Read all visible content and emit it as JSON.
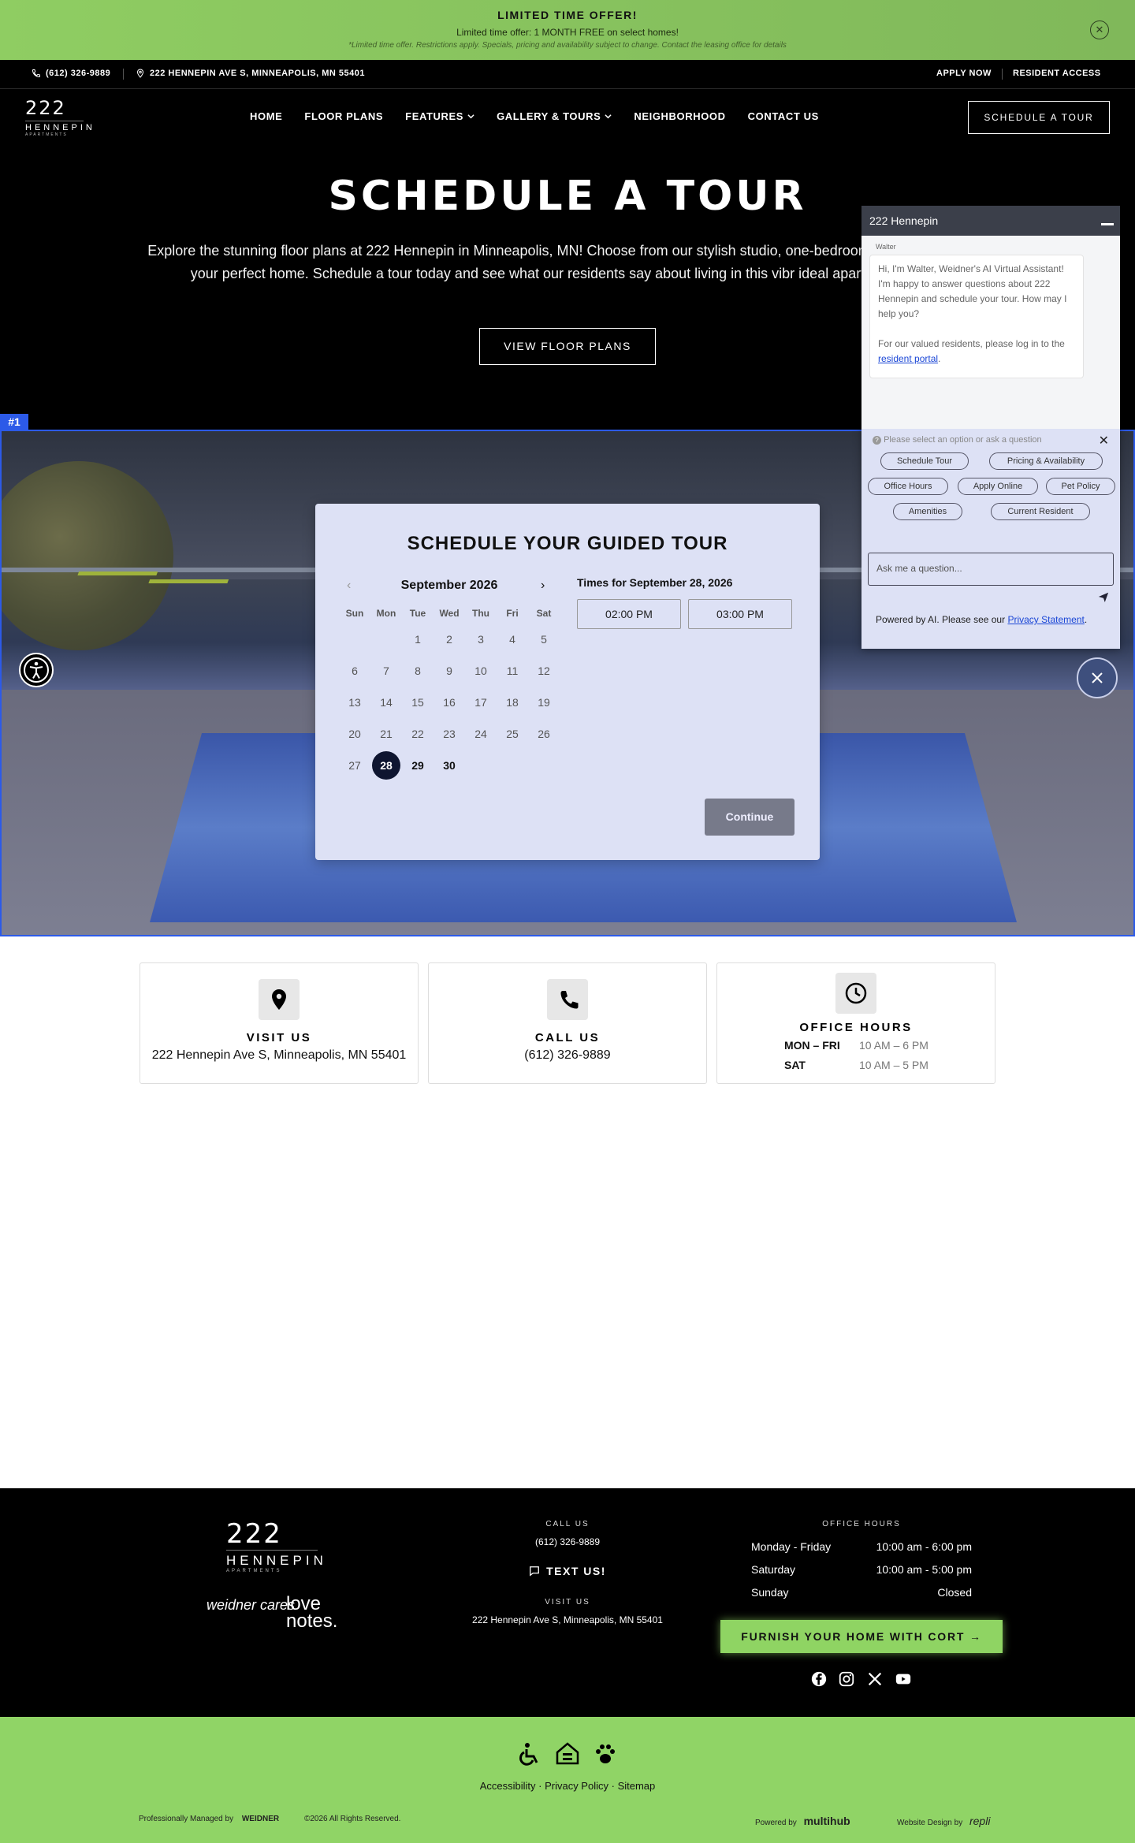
{
  "promo": {
    "title": "LIMITED TIME OFFER!",
    "subtitle": "Limited time offer: 1 MONTH FREE on select homes!",
    "fine_print": "*Limited time offer. Restrictions apply. Specials, pricing and availability subject to change. Contact the leasing office for details",
    "close_icon": "close-icon"
  },
  "utility": {
    "phone": "(612) 326-9889",
    "address": "222 HENNEPIN AVE S, MINNEAPOLIS, MN 55401",
    "apply": "APPLY NOW",
    "resident": "RESIDENT ACCESS"
  },
  "brand": {
    "number": "222",
    "word": "HENNEPIN",
    "sub": "APARTMENTS"
  },
  "nav": {
    "items": [
      "HOME",
      "FLOOR PLANS",
      "FEATURES",
      "GALLERY & TOURS",
      "NEIGHBORHOOD",
      "CONTACT US"
    ],
    "cta": "SCHEDULE A TOUR"
  },
  "hero": {
    "title": "SCHEDULE A TOUR",
    "body": "Explore the stunning floor plans at 222 Hennepin in Minneapolis, MN! Choose from our stylish studio, one-bedroom apartments to find your perfect home. Schedule a tour today and see what our residents say about living in this vibr ideal apartment awaits!",
    "button": "VIEW FLOOR PLANS"
  },
  "frame_tag": "#1",
  "scheduler": {
    "title": "SCHEDULE YOUR GUIDED TOUR",
    "month": "September 2026",
    "weekdays": [
      "Sun",
      "Mon",
      "Tue",
      "Wed",
      "Thu",
      "Fri",
      "Sat"
    ],
    "first_weekday_index": 2,
    "days_in_month": 30,
    "selected_day": 28,
    "available_days": [
      28,
      29,
      30
    ],
    "times_title": "Times for September 28, 2026",
    "times": [
      "02:00 PM",
      "03:00 PM"
    ],
    "continue": "Continue"
  },
  "chat": {
    "title": "222 Hennepin",
    "sender": "Walter",
    "message_1": "Hi, I'm Walter, Weidner's AI Virtual Assistant! I'm happy to answer questions about 222 Hennepin and schedule your tour. How may I help you?",
    "message_2_prefix": "For our valued residents, please log in to the",
    "message_2_link": "resident portal",
    "hint": "Please select an option or ask a question",
    "options": [
      "Schedule Tour",
      "Pricing & Availability",
      "Office Hours",
      "Apply Online",
      "Pet Policy",
      "Amenities",
      "Current Resident"
    ],
    "input_placeholder": "Ask me a question...",
    "powered_prefix": "Powered by AI. Please see our",
    "powered_link": "Privacy Statement"
  },
  "cards": {
    "visit": {
      "title": "VISIT US",
      "value": "222 Hennepin Ave S, Minneapolis, MN 55401",
      "icon": "map-pin-icon"
    },
    "call": {
      "title": "CALL US",
      "value": "(612) 326-9889",
      "icon": "phone-icon"
    },
    "hours": {
      "title": "OFFICE HOURS",
      "icon": "clock-icon",
      "rows": [
        {
          "day": "MON – FRI",
          "time": "10 AM – 6 PM"
        },
        {
          "day": "SAT",
          "time": "10 AM – 5 PM"
        }
      ]
    }
  },
  "footer": {
    "brand_1": "weidner cares",
    "brand_2_line1": "love",
    "brand_2_line2": "notes.",
    "call_label": "CALL US",
    "call_value": "(612) 326-9889",
    "text_us": "TEXT US!",
    "visit_label": "VISIT US",
    "visit_value": "222 Hennepin Ave S, Minneapolis, MN 55401",
    "hours_label": "OFFICE HOURS",
    "hours": [
      {
        "day": "Monday - Friday",
        "time": "10:00 am - 6:00 pm"
      },
      {
        "day": "Saturday",
        "time": "10:00 am - 5:00 pm"
      },
      {
        "day": "Sunday",
        "time": "Closed"
      }
    ],
    "cort": "FURNISH YOUR HOME WITH CORT",
    "social": [
      "facebook-icon",
      "instagram-icon",
      "x-icon",
      "youtube-icon"
    ]
  },
  "bottom": {
    "links": [
      "Accessibility",
      "Privacy Policy",
      "Sitemap"
    ],
    "managed": "Professionally Managed by",
    "managed_brand": "WEIDNER",
    "copyright": "©2026 All Rights Reserved.",
    "powered": "Powered by",
    "powered_brand": "multihub",
    "design": "Website Design by",
    "design_brand": "repli"
  },
  "colors": {
    "promo_green": "#8fcd62",
    "footer_green": "#90d466",
    "scheduler_bg": "#dde1f5",
    "selected_day": "#0e1530",
    "frame_blue": "#2c5ae8"
  }
}
